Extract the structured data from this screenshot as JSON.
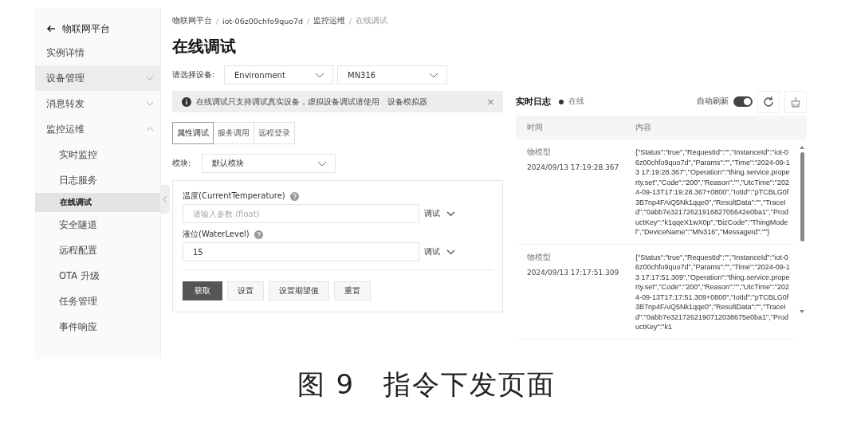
{
  "sidebar": {
    "back": {
      "label": "物联网平台"
    },
    "items": [
      {
        "label": "实例详情",
        "selected": false,
        "hovered": false
      },
      {
        "label": "设备管理",
        "selected": false,
        "hovered": true,
        "expanded": false
      },
      {
        "label": "消息转发",
        "selected": false,
        "hovered": false,
        "expanded": false
      },
      {
        "label": "监控运维",
        "selected": false,
        "hovered": false,
        "expanded": true,
        "children": [
          {
            "label": "实时监控",
            "selected": false,
            "hovered": false
          },
          {
            "label": "日志服务",
            "selected": false,
            "hovered": false
          },
          {
            "label": "在线调试",
            "selected": true,
            "hovered": false
          },
          {
            "label": "安全隧道",
            "selected": false,
            "hovered": false
          },
          {
            "label": "远程配置",
            "selected": false,
            "hovered": false
          },
          {
            "label": "OTA 升级",
            "selected": false,
            "hovered": false
          },
          {
            "label": "任务管理",
            "selected": false,
            "hovered": false
          },
          {
            "label": "事件响应",
            "selected": false,
            "hovered": false
          }
        ]
      }
    ]
  },
  "breadcrumb": [
    {
      "label": "物联网平台",
      "current": false
    },
    {
      "label": "iot-06z00chfo9quo7d",
      "current": false
    },
    {
      "label": "监控运维",
      "current": false
    },
    {
      "label": "在线调试",
      "current": true
    }
  ],
  "page_title": "在线调试",
  "device_select": {
    "label": "请选择设备:",
    "product": "Environment",
    "device": "MN316"
  },
  "notice": {
    "text": "在线调试只支持调试真实设备，虚拟设备调试请使用",
    "link": "设备模拟器",
    "close": "×"
  },
  "tabs": [
    {
      "label": "属性调试",
      "selected": true
    },
    {
      "label": "服务调用",
      "selected": false
    },
    {
      "label": "远程登录",
      "selected": false
    }
  ],
  "module": {
    "label": "模块:",
    "value": "默认模块"
  },
  "properties": [
    {
      "label": "温度(CurrentTemperature)",
      "placeholder": "请输入参数 (float)",
      "action": "调试"
    },
    {
      "label": "液位(WaterLevel)",
      "value": "15",
      "action": "调试"
    }
  ],
  "buttons": [
    {
      "label": "获取",
      "primary": true
    },
    {
      "label": "设置",
      "primary": false
    },
    {
      "label": "设置期望值",
      "primary": false
    },
    {
      "label": "重置",
      "primary": false
    }
  ],
  "log": {
    "title": "实时日志",
    "status": "在线",
    "online": true,
    "auto_refresh": {
      "label": "自动刷新",
      "on": true
    },
    "columns": [
      "时间",
      "内容"
    ],
    "rows": [
      {
        "type": "物模型",
        "time": "2024/09/13 17:19:28.367",
        "content": "{\"Status\":\"true\",\"RequestId\":\"\",\"InstanceId\":\"iot-06z00chfo9quo7d\",\"Params\":\"\",\"Time\":\"2024-09-13 17:19:28.367\",\"Operation\":\"thing.service.property.set\",\"Code\":\"200\",\"Reason\":\"\",\"UtcTime\":\"2024-09-13T17:19:28.367+0800\",\"IotId\":\"pTCBLG0f3B7np4FAiQ5Nk1qqe0\",\"ResultData\":\"\",\"TraceId\":\"0abb7e3217262191682705642e0ba1\",\"ProductKey\":\"k1qqeX1wX0p\",\"BizCode\":\"ThingModel\",\"DeviceName\":\"MN316\",\"MessageId\":\"\"}"
      },
      {
        "type": "物模型",
        "time": "2024/09/13 17:17:51.309",
        "content": "{\"Status\":\"true\",\"RequestId\":\"\",\"InstanceId\":\"iot-06z00chfo9quo7d\",\"Params\":\"\",\"Time\":\"2024-09-13 17:17:51.309\",\"Operation\":\"thing.service.property.set\",\"Code\":\"200\",\"Reason\":\"\",\"UtcTime\":\"2024-09-13T17:17:51.309+0800\",\"IotId\":\"pTCBLG0f3B7np4FAiQ5Nk1qqe0\",\"ResultData\":\"\",\"TraceId\":\"0abb7e3217262190712038675e0ba1\",\"ProductKey\":\"k1"
      }
    ]
  },
  "caption": "图 9　指令下发页面"
}
